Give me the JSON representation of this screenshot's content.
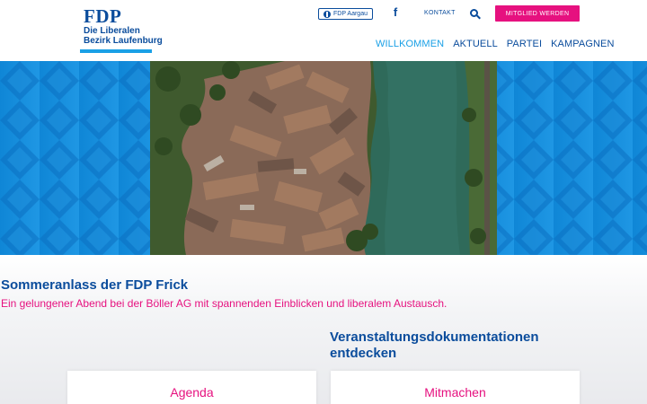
{
  "header": {
    "logo": {
      "brand": "FDP",
      "line1": "Die Liberalen",
      "line2": "Bezirk Laufenburg"
    },
    "top_links": {
      "aargau": "FDP Aargau",
      "facebook_icon": "f",
      "kontakt": "KONTAKT",
      "cta": "MITGLIED WERDEN"
    },
    "nav": [
      {
        "label": "WILLKOMMEN",
        "active": true
      },
      {
        "label": "AKTUELL"
      },
      {
        "label": "PARTEI"
      },
      {
        "label": "KAMPAGNEN"
      }
    ]
  },
  "hero": {
    "image": "aerial-view-of-old-town-and-river"
  },
  "main": {
    "headline": "Sommeranlass der FDP Frick",
    "subline": "Ein gelungener Abend bei der Böller AG mit spannenden Einblicken und liberalem Austausch.",
    "section_title": "Veranstaltungsdokumentationen entdecken",
    "cards": [
      {
        "label": "Agenda"
      },
      {
        "label": "Mitmachen"
      }
    ]
  },
  "colors": {
    "brand_blue": "#0a4c9c",
    "accent_blue": "#1aa0e6",
    "magenta": "#e6117f"
  }
}
